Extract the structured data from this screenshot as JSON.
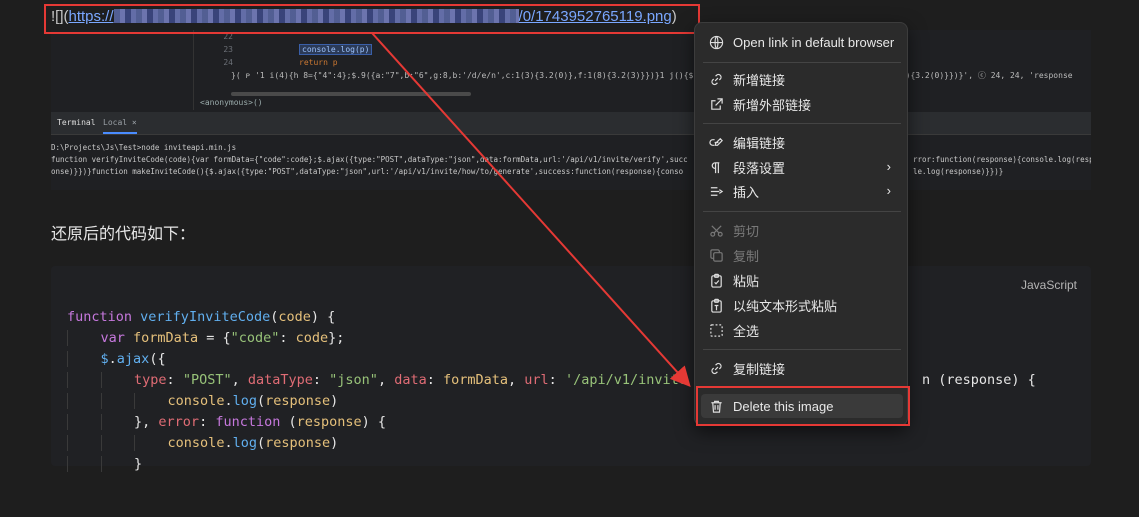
{
  "markdown_link": {
    "prefix": "![](",
    "url_start": "https://",
    "url_end": "/0/1743952765119.png",
    "suffix": ")"
  },
  "ide": {
    "gutter": [
      "",
      "22",
      "23",
      "24"
    ],
    "code_lines": [
      "console.log(p)",
      "return p"
    ],
    "long_line": "}( ᴘ '1 i(4){h 8={\"4\":4};$.9({a:\"7\",b:\"6\",g:8,b:'/d/e/n',c:1(3){3.2(0)},f:1(8){3.2(3)}})}1 j(){$.9(",
    "long_line_right": "(0){3.2(0)}})}', ⓒ 24, 24, 'response",
    "breadcrumb": "<anonymous>()",
    "tab_terminal": "Terminal",
    "tab_local": "Local ×",
    "terminal_lines": [
      "D:\\Projects\\Js\\Test>node inviteapi.min.js",
      "function verifyInviteCode(code){var formData={\"code\":code};$.ajax({type:\"POST\",dataType:\"json\",data:formData,url:'/api/v1/invite/verify',succ",
      "onse)}})}function makeInviteCode(){$.ajax({type:\"POST\",dataType:\"json\",url:'/api/v1/invite/how/to/generate',success:function(response){conso"
    ],
    "terminal_right": [
      "rror:function(response){console.log(resp",
      "le.log(response)}})}"
    ]
  },
  "heading": "还原后的代码如下：",
  "code_block": {
    "language": "JavaScript",
    "lines": [
      "function verifyInviteCode(code) {",
      "    var formData = {\"code\": code};",
      "    $.ajax({",
      "        type: \"POST\", dataType: \"json\", data: formData, url: '/api/v1/invite",
      "            console.log(response)",
      "        }, error: function (response) {",
      "            console.log(response)",
      "        }"
    ],
    "line4_tail": "n (response) {"
  },
  "context_menu": {
    "items": [
      {
        "label": "Open link in default browser",
        "icon": "globe-icon",
        "disabled": false
      },
      {
        "label": "新增链接",
        "icon": "link-icon",
        "disabled": false
      },
      {
        "label": "新增外部链接",
        "icon": "external-link-icon",
        "disabled": false
      },
      {
        "label": "编辑链接",
        "icon": "edit-link-icon",
        "disabled": false
      },
      {
        "label": "段落设置",
        "icon": "pilcrow-icon",
        "disabled": false,
        "submenu": true
      },
      {
        "label": "插入",
        "icon": "insert-icon",
        "disabled": false,
        "submenu": true
      },
      {
        "label": "剪切",
        "icon": "scissors-icon",
        "disabled": true
      },
      {
        "label": "复制",
        "icon": "copy-icon",
        "disabled": true
      },
      {
        "label": "粘贴",
        "icon": "clipboard-icon",
        "disabled": false
      },
      {
        "label": "以纯文本形式粘贴",
        "icon": "paste-plain-icon",
        "disabled": false
      },
      {
        "label": "全选",
        "icon": "select-all-icon",
        "disabled": false
      },
      {
        "label": "复制链接",
        "icon": "link-icon",
        "disabled": false
      },
      {
        "label": "Delete this image",
        "icon": "trash-icon",
        "disabled": false
      }
    ],
    "chevron": "›"
  },
  "colors": {
    "annotation_red": "#e53935",
    "menu_bg": "#2b2b2b"
  }
}
